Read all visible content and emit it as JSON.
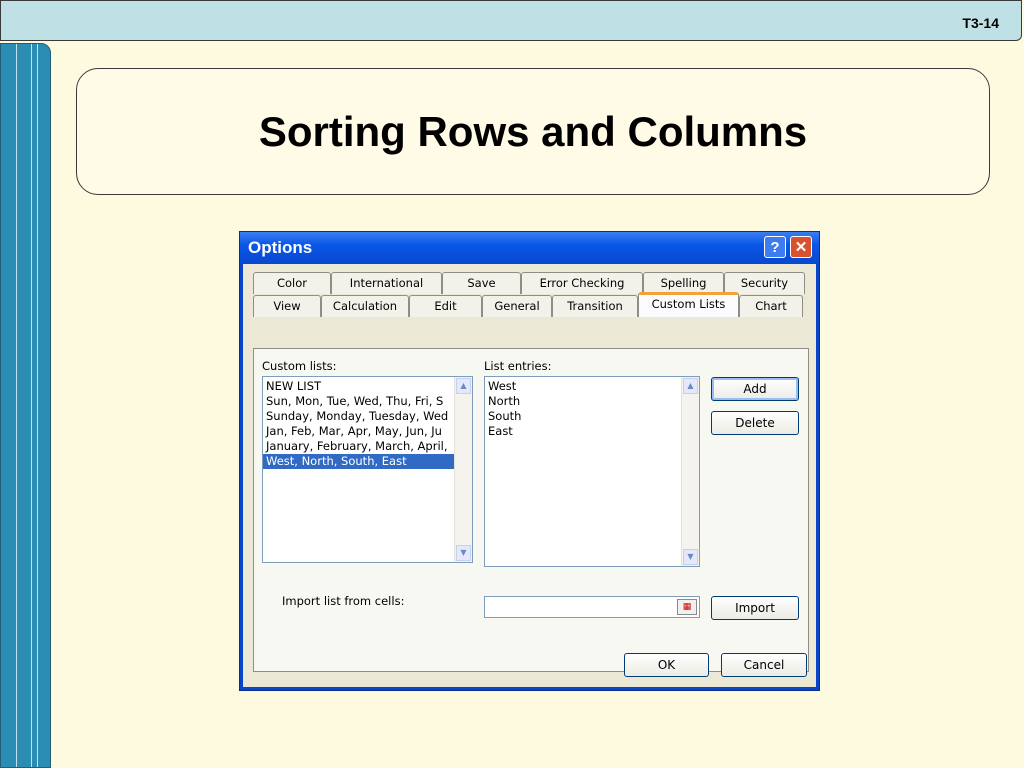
{
  "slide": {
    "number": "T3-14",
    "title": "Sorting Rows and Columns"
  },
  "dialog": {
    "title": "Options",
    "help_label": "?",
    "close_label": "✕",
    "tabs_row1": [
      "Color",
      "International",
      "Save",
      "Error Checking",
      "Spelling",
      "Security"
    ],
    "tabs_row2": [
      "View",
      "Calculation",
      "Edit",
      "General",
      "Transition",
      "Custom Lists",
      "Chart"
    ],
    "active_tab": "Custom Lists",
    "custom_lists_label": "Custom lists:",
    "custom_lists": [
      "NEW LIST",
      "Sun, Mon, Tue, Wed, Thu, Fri, S",
      "Sunday, Monday, Tuesday, Wed",
      "Jan, Feb, Mar, Apr, May, Jun, Ju",
      "January, February, March, April,",
      "West, North, South, East"
    ],
    "selected_list_index": 5,
    "list_entries_label": "List entries:",
    "list_entries": [
      "West",
      "North",
      "South",
      "East"
    ],
    "add_label": "Add",
    "delete_label": "Delete",
    "import_label": "Import list from cells:",
    "import_value": "",
    "import_button": "Import",
    "ok_label": "OK",
    "cancel_label": "Cancel",
    "colors": {
      "title_bar": "#0a57e6",
      "selection": "#316ac5",
      "active_tab_accent": "#f1a33a",
      "slide_background": "#fdfadf",
      "sidebar": "#2b8db3"
    }
  }
}
